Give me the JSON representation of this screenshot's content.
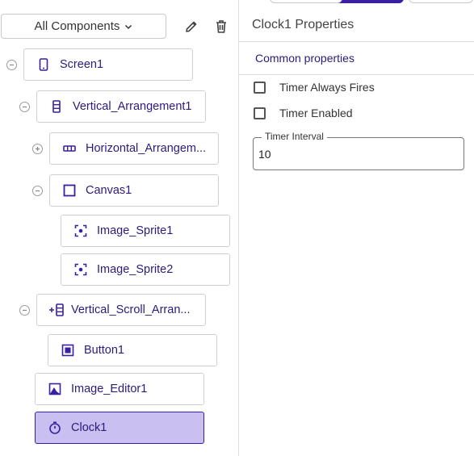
{
  "tree": {
    "filter_label": "All Components",
    "tool_icons": [
      "pencil-icon",
      "trash-icon"
    ],
    "nodes": [
      {
        "label": "Screen1",
        "icon": "phone-icon",
        "toggle": "collapse"
      },
      {
        "label": "Vertical_Arrangement1",
        "icon": "vertical-arrangement-icon",
        "toggle": "collapse"
      },
      {
        "label": "Horizontal_Arrangem...",
        "icon": "horizontal-arrangement-icon",
        "toggle": "expand"
      },
      {
        "label": "Canvas1",
        "icon": "canvas-icon",
        "toggle": "collapse"
      },
      {
        "label": "Image_Sprite1",
        "icon": "sprite-icon",
        "toggle": "none"
      },
      {
        "label": "Image_Sprite2",
        "icon": "sprite-icon",
        "toggle": "none"
      },
      {
        "label": "Vertical_Scroll_Arran...",
        "icon": "vertical-scroll-arrangement-icon",
        "toggle": "collapse"
      },
      {
        "label": "Button1",
        "icon": "button-icon",
        "toggle": "none"
      },
      {
        "label": "Image_Editor1",
        "icon": "image-editor-icon",
        "toggle": "none"
      },
      {
        "label": "Clock1",
        "icon": "clock-icon",
        "toggle": "none",
        "selected": true
      }
    ]
  },
  "properties": {
    "title": "Clock1 Properties",
    "section": "Common properties",
    "timer_always_fires": {
      "label": "Timer Always Fires",
      "checked": false
    },
    "timer_enabled": {
      "label": "Timer Enabled",
      "checked": false
    },
    "timer_interval": {
      "label": "Timer Interval",
      "value": "10"
    }
  },
  "colors": {
    "accent": "#3a1fa0",
    "selected_bg": "#c9bff0",
    "text": "#2e1a7a"
  }
}
